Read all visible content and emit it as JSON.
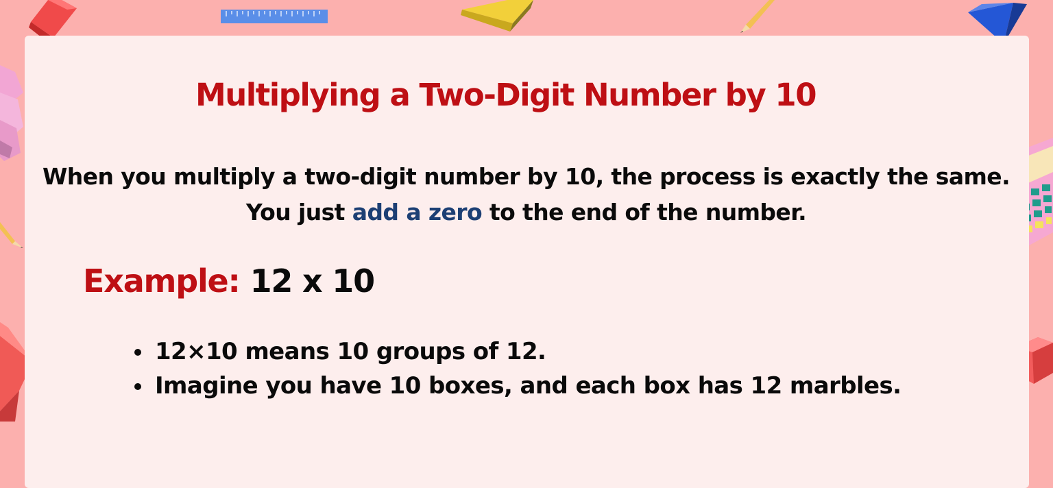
{
  "title": "Multiplying a Two-Digit Number by 10",
  "intro": {
    "before": "When you multiply a two-digit number by 10, the process is exactly the same. You just ",
    "highlight": "add a zero",
    "after": " to the end of the number."
  },
  "example": {
    "label": "Example:",
    "expression": "12 x 10"
  },
  "bullets": [
    "12×10 means 10 groups of 12.",
    "Imagine you have 10 boxes, and each box has 12 marbles."
  ],
  "colors": {
    "background": "#fcb0ae",
    "card": "#fdeeed",
    "title": "#be0f14",
    "highlight": "#1c3f74",
    "text": "#0a0a0a"
  },
  "decorations": [
    "red-cube-icon",
    "ruler-icon",
    "yellow-prism-icon",
    "pencil-icon",
    "blue-pyramid-icon",
    "pink-blocks-icon",
    "calculator-icon",
    "red-block-icon"
  ]
}
